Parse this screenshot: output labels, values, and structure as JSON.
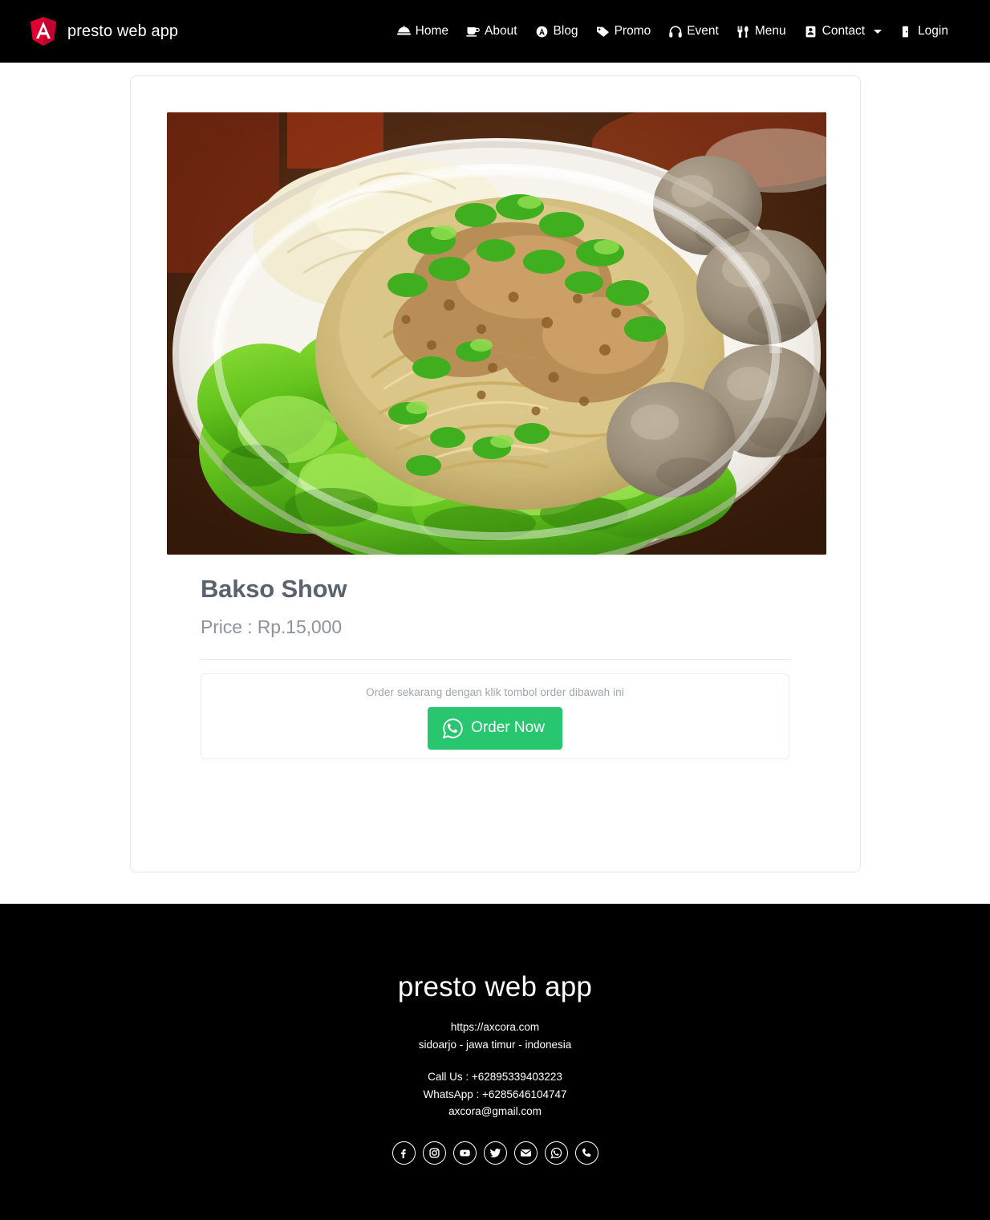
{
  "navbar": {
    "brand": "presto web app",
    "brand_logo_icon": "angular-shield-icon",
    "links": [
      {
        "label": "Home",
        "icon": "food-dome-icon"
      },
      {
        "label": "About",
        "icon": "coffee-cup-icon"
      },
      {
        "label": "Blog",
        "icon": "angular-logo-icon"
      },
      {
        "label": "Promo",
        "icon": "tag-icon"
      },
      {
        "label": "Event",
        "icon": "headphones-icon"
      },
      {
        "label": "Menu",
        "icon": "utensils-icon"
      },
      {
        "label": "Contact",
        "icon": "address-card-icon",
        "has_caret": true
      },
      {
        "label": "Login",
        "icon": "door-open-icon"
      }
    ]
  },
  "product": {
    "image_alt": "bakso noodle bowl with meatballs and lettuce",
    "title": "Bakso Show",
    "price": "Price : Rp.15,000",
    "order_hint": "Order sekarang dengan klik tombol order dibawah ini",
    "order_button_label": "Order Now",
    "order_button_icon": "whatsapp-icon",
    "order_button_color": "#28c76f"
  },
  "footer": {
    "title": "presto web app",
    "website": "https://axcora.com",
    "address": "sidoarjo - jawa timur - indonesia",
    "call_us": "Call Us : +62895339403223",
    "whatsapp": "WhatsApp : +6285646104747",
    "email": "axcora@gmail.com",
    "socials": [
      {
        "name": "facebook-icon"
      },
      {
        "name": "instagram-icon"
      },
      {
        "name": "youtube-icon"
      },
      {
        "name": "twitter-icon"
      },
      {
        "name": "envelope-icon"
      },
      {
        "name": "whatsapp-icon"
      },
      {
        "name": "phone-icon"
      }
    ]
  },
  "theme": {
    "nav_background": "#000000",
    "accent_green": "#28c76f",
    "angular_red": "#dd0031",
    "title_color": "#5a6270",
    "price_color": "#8d939e"
  }
}
